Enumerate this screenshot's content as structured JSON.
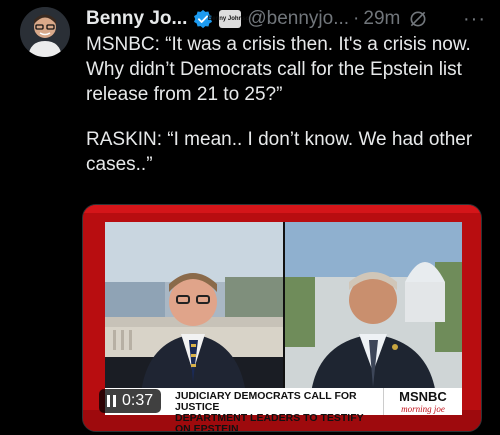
{
  "tweet": {
    "author_name": "Benny Jo...",
    "handle": "@bennyjo...",
    "separator": "·",
    "time": "29m",
    "affiliation_badge": "Benny Johnson",
    "more": "···",
    "paragraphs": [
      "MSNBC: “It was a crisis then. It's a crisis now. Why didn’t Democrats call for the Epstein list release from 21 to 25?”",
      "RASKIN: “I mean.. I don’t know. We had other cases..”"
    ]
  },
  "video": {
    "time": "0:37",
    "chyron_line1": "JUDICIARY DEMOCRATS CALL FOR JUSTICE",
    "chyron_line2": "DEPARTMENT LEADERS TO TESTIFY ON EPSTEIN",
    "network": "MSNBC",
    "show": "morning joe"
  },
  "colors": {
    "verified": "#1d9bf0",
    "muted": "#71767b",
    "frame_red": "#b80d10"
  },
  "icons": {
    "verified": "verified-badge-icon",
    "grok": "grok-icon",
    "more": "more-icon",
    "pause": "pause-icon"
  }
}
